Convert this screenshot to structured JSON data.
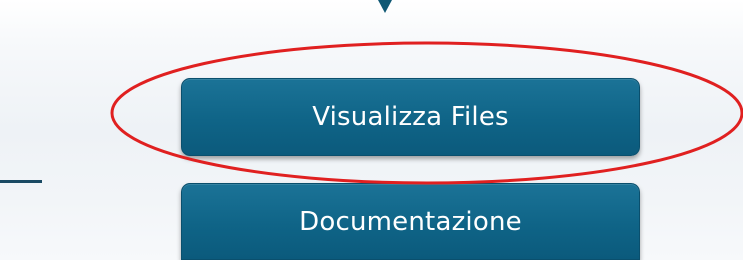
{
  "buttons": {
    "visualizza_files_label": "Visualizza Files",
    "documentazione_label": "Documentazione"
  },
  "colors": {
    "button_primary": "#0f6487",
    "highlight_annotation": "#e02020",
    "connector_line": "#1a4a64"
  }
}
